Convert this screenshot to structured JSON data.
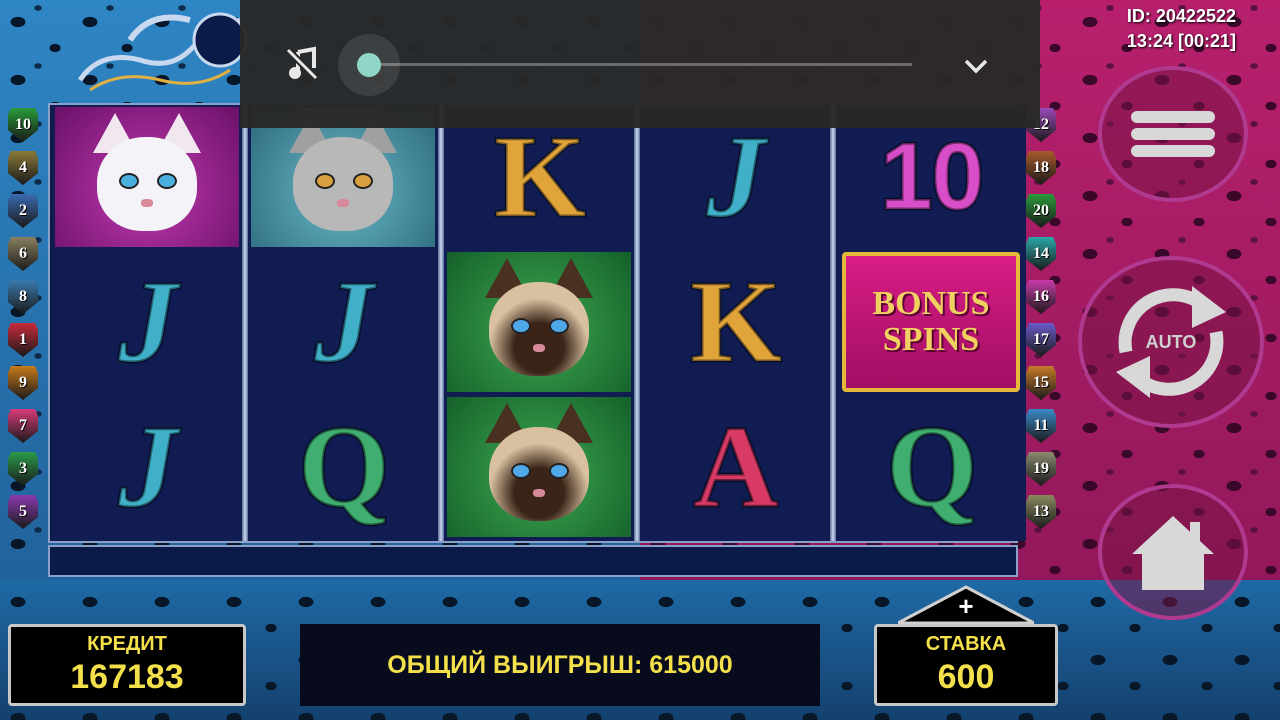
{
  "session": {
    "id": "ID: 20422522",
    "time": "13:24 [00:21]"
  },
  "media": {
    "mute_icon": "music-off-icon",
    "volume_fraction": 0.0,
    "collapse_icon": "chevron-down-icon"
  },
  "left_lines": [
    "10",
    "4",
    "2",
    "6",
    "8",
    "1",
    "9",
    "7",
    "3",
    "5"
  ],
  "right_lines": [
    "12",
    "18",
    "20",
    "14",
    "16",
    "17",
    "15",
    "11",
    "19",
    "13"
  ],
  "left_line_colors": [
    "#2a9a3a",
    "#8a7a3a",
    "#3a6ab0",
    "#8a8060",
    "#3a7ab0",
    "#c82a3a",
    "#c87a1a",
    "#d83a7a",
    "#2a9a4a",
    "#8a3ab0"
  ],
  "right_line_colors": [
    "#9a4ab8",
    "#a85a2a",
    "#2a9a3a",
    "#2aa8a8",
    "#c83aa8",
    "#6a5ac8",
    "#c87a2a",
    "#3a8ac8",
    "#8a8a70",
    "#8a8a60"
  ],
  "reels": [
    [
      {
        "type": "cat",
        "variant": "white"
      },
      {
        "type": "letter",
        "value": "J"
      },
      {
        "type": "letter",
        "value": "J"
      }
    ],
    [
      {
        "type": "cat",
        "variant": "silver"
      },
      {
        "type": "letter",
        "value": "J"
      },
      {
        "type": "letter",
        "value": "Q"
      }
    ],
    [
      {
        "type": "letter",
        "value": "K"
      },
      {
        "type": "cat",
        "variant": "siamese"
      },
      {
        "type": "cat",
        "variant": "siamese"
      }
    ],
    [
      {
        "type": "letter",
        "value": "J"
      },
      {
        "type": "letter",
        "value": "K"
      },
      {
        "type": "letter",
        "value": "A"
      }
    ],
    [
      {
        "type": "letter",
        "value": "10"
      },
      {
        "type": "bonus",
        "line1": "BONUS",
        "line2": "SPINS"
      },
      {
        "type": "letter",
        "value": "Q"
      }
    ]
  ],
  "buttons": {
    "menu_icon": "menu-icon",
    "auto_label": "AUTO",
    "home_icon": "home-icon"
  },
  "credit": {
    "label": "КРЕДИТ",
    "value": "167183"
  },
  "total_win": {
    "text": "ОБЩИЙ ВЫИГРЫШ: 615000"
  },
  "bet": {
    "label": "СТАВКА",
    "value": "600",
    "increase_label": "+"
  }
}
